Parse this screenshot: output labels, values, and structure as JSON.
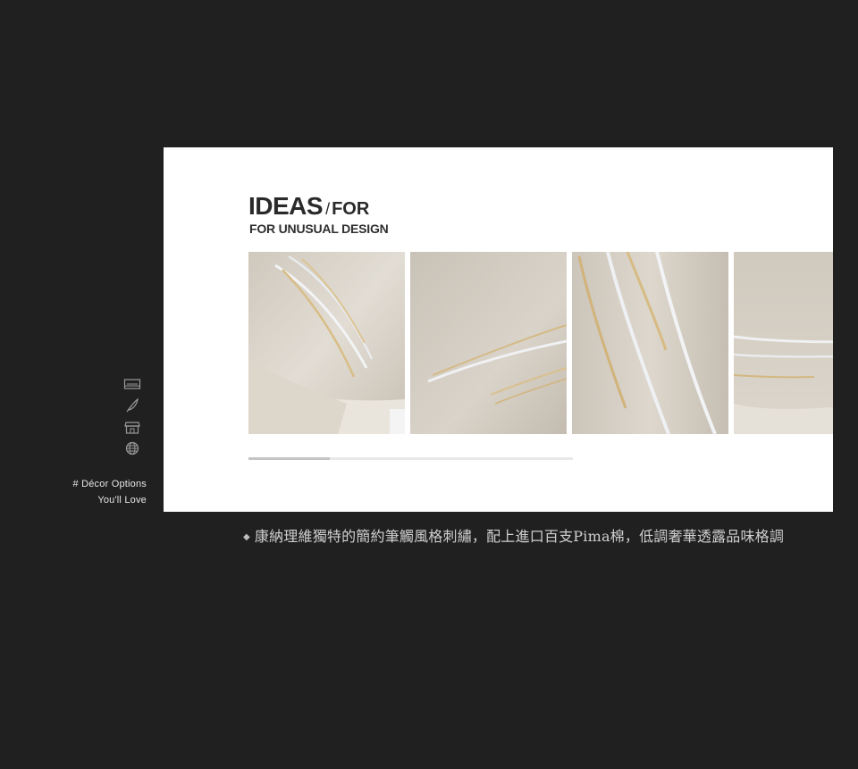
{
  "sidebar": {
    "icons": [
      {
        "name": "bed-icon"
      },
      {
        "name": "feather-icon"
      },
      {
        "name": "store-icon"
      },
      {
        "name": "globe-icon"
      }
    ],
    "tag_line1": "# Décor Options",
    "tag_line2": "You'll Love"
  },
  "header": {
    "title": "IDEAS",
    "slash": "/",
    "title_for": "FOR",
    "subtitle": "FOR UNUSUAL DESIGN"
  },
  "gallery": {
    "progress": 0.25
  },
  "caption": {
    "marker": "◆",
    "text": "康納理維獨特的簡約筆觸風格刺繡，配上進口百支Pima棉，低調奢華透露品味格調"
  },
  "colors": {
    "background": "#202020",
    "panel": "#ffffff",
    "fabric": "#d8d2c8",
    "gold_thread": "#d2b680",
    "silver_thread": "#f1f2f4"
  }
}
